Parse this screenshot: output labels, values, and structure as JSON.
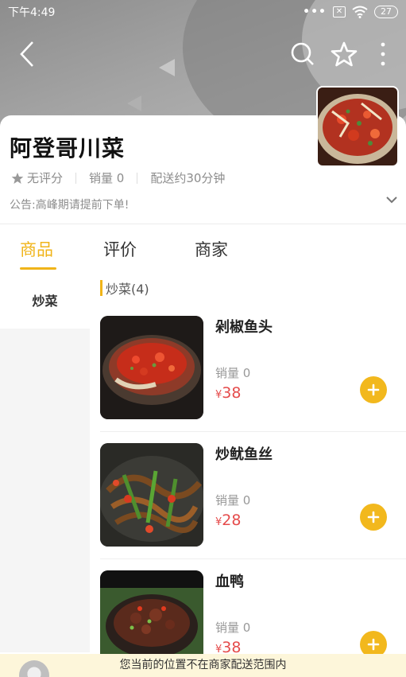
{
  "status_bar": {
    "time": "下午4:49",
    "dots": "•••",
    "sim_label": "✕",
    "battery": "27"
  },
  "nav": {
    "back_icon": "chevron-left-icon",
    "search_icon": "search-icon",
    "favorite_icon": "star-outline-icon",
    "more_icon": "more-vertical-icon"
  },
  "shop": {
    "name": "阿登哥川菜",
    "rating": "无评分",
    "sales": "销量 0",
    "delivery": "配送约30分钟",
    "notice": "公告:高峰期请提前下单!"
  },
  "tabs": [
    {
      "label": "商品",
      "active": true
    },
    {
      "label": "评价",
      "active": false
    },
    {
      "label": "商家",
      "active": false
    }
  ],
  "categories": [
    {
      "label": "炒菜",
      "active": true
    }
  ],
  "section": {
    "title": "炒菜(4)"
  },
  "products": [
    {
      "name": "剁椒鱼头",
      "sales": "销量 0",
      "currency": "¥",
      "price": "38"
    },
    {
      "name": "炒鱿鱼丝",
      "sales": "销量 0",
      "currency": "¥",
      "price": "28"
    },
    {
      "name": "血鸭",
      "sales": "销量 0",
      "currency": "¥",
      "price": "38"
    }
  ],
  "bottom_notice": "您当前的位置不在商家配送范围内",
  "colors": {
    "accent": "#f0b419",
    "price": "#e54b4b",
    "notice_bg": "#fdf6da"
  }
}
